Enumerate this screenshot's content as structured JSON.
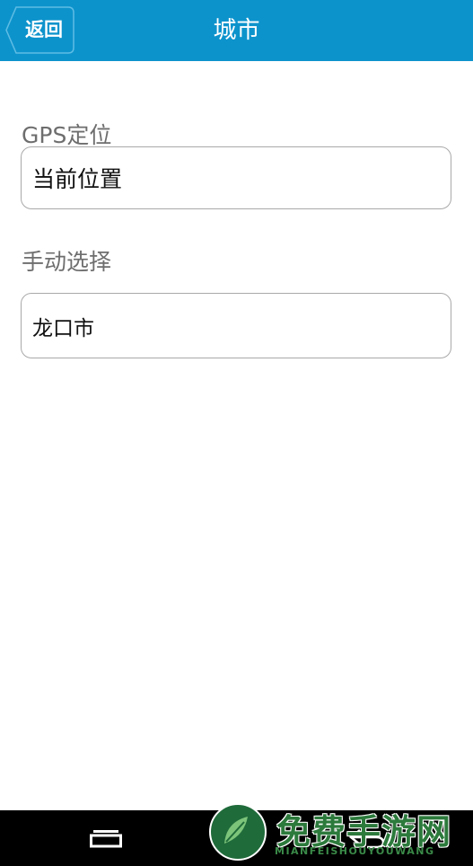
{
  "header": {
    "back_label": "返回",
    "title": "城市",
    "color": "#0d93cc"
  },
  "gps": {
    "label": "GPS定位",
    "value": "当前位置"
  },
  "manual": {
    "label": "手动选择",
    "value": "龙口市"
  },
  "navbar": {
    "icons": [
      "recent-apps-icon",
      "home-icon",
      "back-icon"
    ]
  },
  "watermark": {
    "title": "免费手游网",
    "subtitle": "MIANFEISHOUYOUWANG"
  }
}
